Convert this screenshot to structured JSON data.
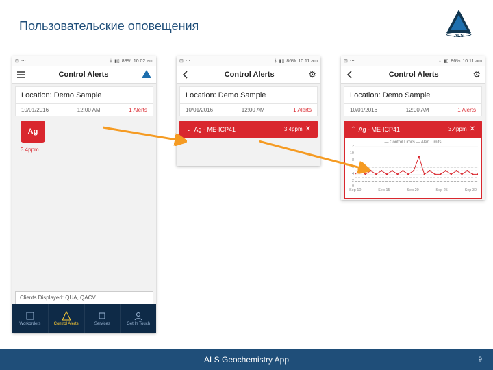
{
  "slide": {
    "title": "Пользовательские оповещения",
    "footer_title": "ALS Geochemistry App",
    "page_number": "9"
  },
  "logo_text": "ALS",
  "phones": {
    "status": {
      "dots": "⋯",
      "bt": "ᚼ",
      "signal": "▮▯",
      "wifi": "⋰",
      "batt1": "88%",
      "time1": "10:02 am",
      "batt2": "86%",
      "time2": "10:11 am",
      "batt3": "86%",
      "time3": "10:11 am",
      "screenshot_icon": "⊡"
    },
    "appbar_title": "Control Alerts",
    "location": "Location: Demo Sample",
    "date": "10/01/2016",
    "time": "12:00 AM",
    "alerts_count": "1 Alerts",
    "chip_element": "Ag",
    "chip_value": "3.4ppm",
    "alert_label": "Ag - ME-ICP41",
    "alert_value": "3.4ppm",
    "clients_displayed": "Clients Displayed:   QUA, QACV",
    "tabs": {
      "workorders": "Workorders",
      "control_alerts": "Control Alerts",
      "services": "Services",
      "get_in_touch": "Get In Touch"
    },
    "chart_legend": "— Control Limits    — Alert Limits"
  },
  "chart_data": {
    "type": "line",
    "title": "",
    "xlabel": "",
    "ylabel": "",
    "ylim": [
      0,
      12
    ],
    "x_categories": [
      "Sep 10",
      "Sep 15",
      "Sep 20",
      "Sep 25",
      "Sep 30"
    ],
    "y_ticks": [
      0,
      2,
      4,
      6,
      8,
      10,
      12
    ],
    "series": [
      {
        "name": "Ag ME-ICP41",
        "values": [
          4,
          5,
          4,
          5,
          4,
          5,
          4,
          5,
          4,
          5,
          4,
          5,
          9,
          4,
          5,
          4,
          4,
          5,
          4,
          5,
          4,
          5,
          4,
          4
        ]
      }
    ],
    "control_limits": [
      2,
      6
    ],
    "alert_limits": [
      3,
      5
    ]
  }
}
